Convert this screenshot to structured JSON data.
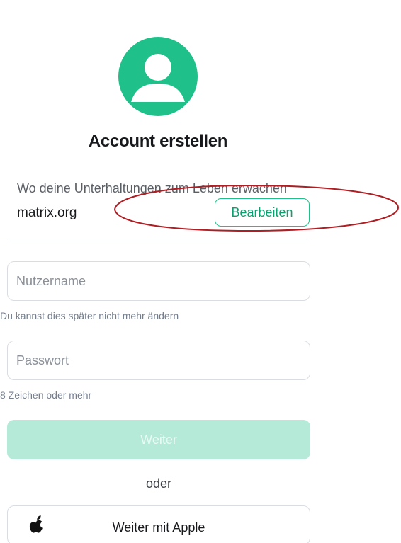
{
  "header": {
    "avatar_icon": "user-avatar-icon",
    "title": "Account erstellen"
  },
  "server": {
    "description": "Wo deine Unterhaltungen zum Leben erwachen",
    "name": "matrix.org",
    "edit_label": "Bearbeiten"
  },
  "form": {
    "username": {
      "value": "",
      "placeholder": "Nutzername",
      "helper": "Du kannst dies später nicht mehr ändern"
    },
    "password": {
      "value": "",
      "placeholder": "Passwort",
      "helper": "8 Zeichen oder mehr"
    },
    "continue_label": "Weiter",
    "continue_enabled": false
  },
  "alternatives": {
    "or_label": "oder",
    "apple_label": "Weiter mit Apple",
    "apple_icon": "apple-logo-icon"
  },
  "colors": {
    "accent": "#1fc08a",
    "accent_disabled": "#b5ead8",
    "annotation": "#b01e23"
  }
}
